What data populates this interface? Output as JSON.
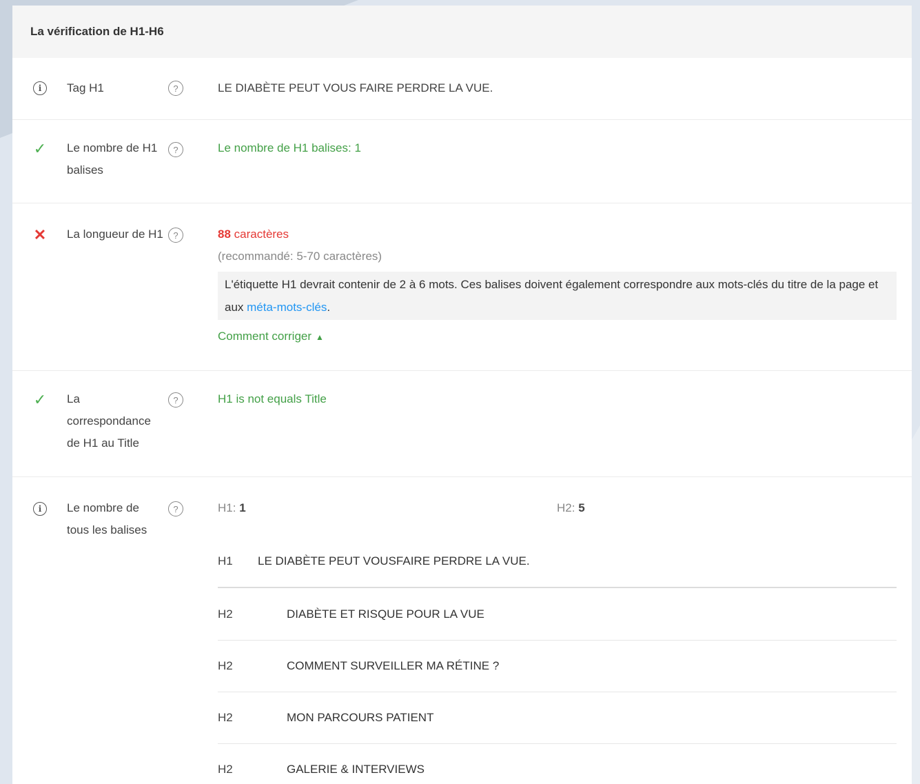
{
  "panel": {
    "title": "La vérification de H1-H6"
  },
  "rows": {
    "tag_h1": {
      "label": "Tag H1",
      "value": "LE DIABÈTE PEUT VOUS FAIRE PERDRE LA VUE."
    },
    "count_h1": {
      "label": "Le nombre de H1 balises",
      "value": "Le nombre de H1 balises: 1"
    },
    "length_h1": {
      "label": "La longueur de H1",
      "chars_count": "88",
      "chars_label": " caractères",
      "recommended": "(recommandé: 5-70 caractères)",
      "advice_text": "L'étiquette H1 devrait contenir de 2 à 6 mots. Ces balises doivent également correspondre aux mots-clés du titre de la page et aux ",
      "advice_link": "méta-mots-clés",
      "advice_end": ".",
      "fix_label": "Comment corriger"
    },
    "match_title": {
      "label": "La correspondance de H1 au Title",
      "value": "H1 is not equals Title"
    },
    "all_headings": {
      "label": "Le nombre de tous les balises",
      "h1_count_label": "H1: ",
      "h1_count": "1",
      "h2_count_label": "H2: ",
      "h2_count": "5",
      "headings": [
        {
          "level": "H1",
          "text": "LE DIABÈTE PEUT VOUSFAIRE PERDRE LA VUE."
        },
        {
          "level": "H2",
          "text": "DIABÈTE ET RISQUE POUR LA VUE"
        },
        {
          "level": "H2",
          "text": "COMMENT SURVEILLER MA RÉTINE ?"
        },
        {
          "level": "H2",
          "text": "MON PARCOURS PATIENT"
        },
        {
          "level": "H2",
          "text": "GALERIE & INTERVIEWS"
        }
      ]
    }
  },
  "colors": {
    "pass": "#43a047",
    "fail": "#e53935",
    "link": "#2196f3"
  },
  "icons": {
    "info": "info-icon",
    "pass": "check-icon",
    "fail": "cross-icon",
    "help": "help-icon",
    "expand": "chevron-up-icon"
  }
}
